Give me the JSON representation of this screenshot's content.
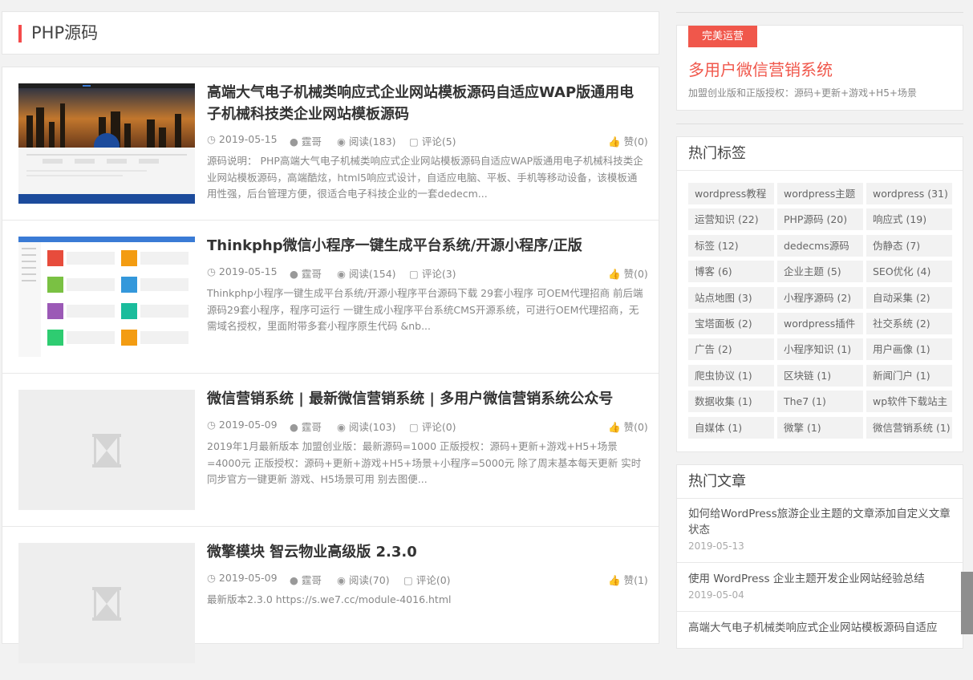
{
  "category": {
    "title": "PHP源码"
  },
  "posts": [
    {
      "title": "高端大气电子机械类响应式企业网站模板源码自适应WAP版通用电子机械科技类企业网站模板源码",
      "date": "2019-05-15",
      "author": "霆哥",
      "views": "阅读(183)",
      "comments": "评论(5)",
      "likes": "赞(0)",
      "excerpt": "源码说明： PHP高端大气电子机械类响应式企业网站模板源码自适应WAP版通用电子机械科技类企业网站模板源码，高端酷炫，html5响应式设计，自适应电脑、平板、手机等移动设备，该模板通用性强，后台管理方便，很适合电子科技企业的一套dedecm...",
      "thumb": "city-night-template"
    },
    {
      "title": "Thinkphp微信小程序一键生成平台系统/开源小程序/正版",
      "date": "2019-05-15",
      "author": "霆哥",
      "views": "阅读(154)",
      "comments": "评论(3)",
      "likes": "赞(0)",
      "excerpt": "Thinkphp小程序一键生成平台系统/开源小程序平台源码下载 29套小程序 可OEM代理招商 前后端源码29套小程序，程序可运行 一键生成小程序平台系统CMS开源系统，可进行OEM代理招商，无需域名授权，里面附带多套小程序原生代码 &nb...",
      "thumb": "admin-dashboard-tiles"
    },
    {
      "title": "微信营销系统 | 最新微信营销系统 | 多用户微信营销系统公众号",
      "date": "2019-05-09",
      "author": "霆哥",
      "views": "阅读(103)",
      "comments": "评论(0)",
      "likes": "赞(0)",
      "excerpt": "2019年1月最新版本 加盟创业版：最新源码=1000 正版授权：源码+更新+游戏+H5+场景=4000元 正版授权：源码+更新+游戏+H5+场景+小程序=5000元 除了周末基本每天更新 实时同步官方一键更新 游戏、H5场景可用 别去图便...",
      "thumb": "hourglass-placeholder"
    },
    {
      "title": "微擎模块 智云物业高级版 2.3.0",
      "date": "2019-05-09",
      "author": "霆哥",
      "views": "阅读(70)",
      "comments": "评论(0)",
      "likes": "赞(1)",
      "excerpt": " 最新版本2.3.0 https://s.we7.cc/module-4016.html",
      "thumb": "hourglass-placeholder"
    }
  ],
  "ad": {
    "badge": "完美运营",
    "title": "多用户微信营销系统",
    "desc": "加盟创业版和正版授权：源码+更新+游戏+H5+场景"
  },
  "tags": {
    "title": "热门标签",
    "items": [
      "wordpress教程",
      "wordpress主题",
      "wordpress (31)",
      "运营知识 (22)",
      "PHP源码 (20)",
      "响应式 (19)",
      "标签 (12)",
      "dedecms源码",
      "伪静态 (7)",
      "博客 (6)",
      "企业主题 (5)",
      "SEO优化 (4)",
      "站点地图 (3)",
      "小程序源码 (2)",
      "自动采集 (2)",
      "宝塔面板 (2)",
      "wordpress插件",
      "社交系统 (2)",
      "广告 (2)",
      "小程序知识 (1)",
      "用户画像 (1)",
      "爬虫协议 (1)",
      "区块链 (1)",
      "新闻门户 (1)",
      "数据收集 (1)",
      "The7 (1)",
      "wp软件下载站主",
      "自媒体 (1)",
      "微擎 (1)",
      "微信营销系统 (1)"
    ]
  },
  "hot": {
    "title": "热门文章",
    "items": [
      {
        "title": "如何给WordPress旅游企业主题的文章添加自定义文章状态",
        "date": "2019-05-13"
      },
      {
        "title": "使用 WordPress 企业主题开发企业网站经验总结",
        "date": "2019-05-04"
      },
      {
        "title": "高端大气电子机械类响应式企业网站模板源码自适应",
        "date": ""
      }
    ]
  },
  "colors": {
    "accent": "#f44b4b",
    "ad_red": "#f0574b"
  }
}
